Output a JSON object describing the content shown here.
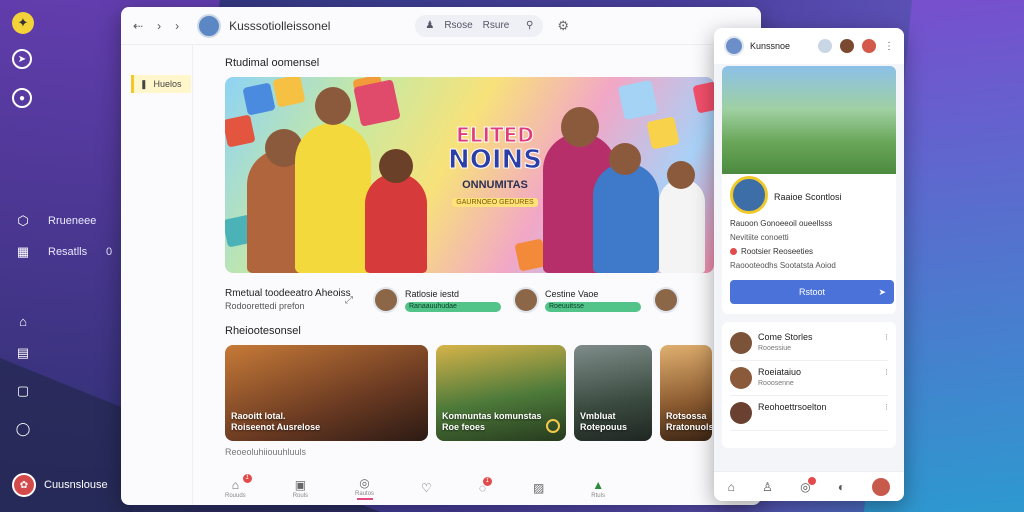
{
  "rail": {
    "label_1": "Rrueneee",
    "label_2": "Resatlls",
    "label_2_count": "0",
    "user_name": "Cuusnslouse"
  },
  "window": {
    "title": "Kusssotiolleissonel",
    "search": {
      "label_a": "Rsose",
      "label_b": "Rsure"
    },
    "side_tab": "Huelos",
    "section_featured": "Rtudimal oomensel",
    "hero": {
      "line1": "ELITED",
      "line2": "NOINS",
      "line3": "ONNUMITAS",
      "line4": "GAURNOEO GEDURES"
    },
    "event_title": "Rmetual toodeeatro Aheoiss",
    "event_sub": "Rodoorettedi prefon",
    "chips": [
      {
        "name": "Ratlosie iestd",
        "pill": "Ranaauuhudae"
      },
      {
        "name": "Cestine Vaoe",
        "pill": "Roeuuitsse"
      }
    ],
    "section_recent": "Rheiootesonsel",
    "cards": [
      {
        "caption_1": "Raooitt lotal.",
        "caption_2": "Roiseenot Ausrelose"
      },
      {
        "caption_1": "Komnuntas komunstas",
        "caption_2": "Roe feoes"
      },
      {
        "caption_1": "Vmbluat",
        "caption_2": "Rotepouus"
      },
      {
        "caption_1": "Rotsossa",
        "caption_2": "Rratonuols"
      }
    ],
    "more_label": "Reoeoluhiiouuhluuls",
    "bottom_nav": [
      {
        "label": "Rouuds",
        "badge": "1"
      },
      {
        "label": "Rouls",
        "badge": ""
      },
      {
        "label": "Rautos",
        "badge": ""
      },
      {
        "label": "",
        "badge": ""
      },
      {
        "label": "",
        "badge": "1"
      },
      {
        "label": "",
        "badge": ""
      },
      {
        "label": "Rtuls",
        "badge": ""
      }
    ]
  },
  "phone": {
    "user": "Kunssnoe",
    "profile_name": "Raaioe Scontlosi",
    "line_1": "Rauoon Gonoeeoil oueellsss",
    "line_2": "Nevitiite conoetti",
    "location": "Rootsier Reoseeties",
    "line_3": "Raoooteodhs Sootatsta Aoiod",
    "button": "Rstoot",
    "list": [
      {
        "title": "Come Storles",
        "sub": "Rooessiue"
      },
      {
        "title": "Roeiataiuo",
        "sub": "Rooosenne"
      },
      {
        "title": "Reohoettrsoelton",
        "sub": ""
      }
    ]
  },
  "colors": {
    "accent_blue": "#4a72d9",
    "accent_yellow": "#f0c929",
    "accent_green": "#52c48a",
    "badge_red": "#e24b4b"
  }
}
